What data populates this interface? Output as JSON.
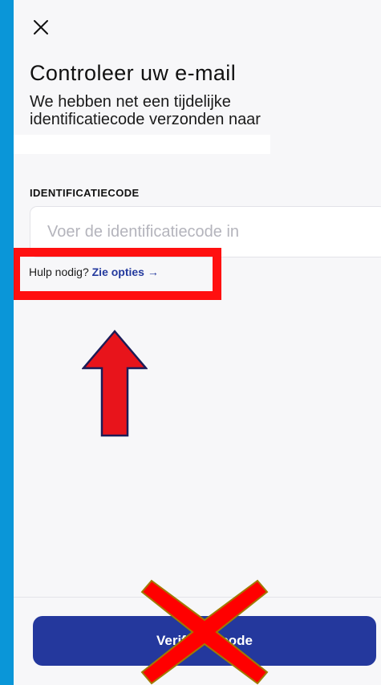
{
  "page": {
    "close_icon": "close-icon",
    "title": "Controleer uw e-mail",
    "subtitle": "We hebben net een tijdelijke identificatiecode verzonden naar",
    "email_value": ""
  },
  "form": {
    "code_label": "IDENTIFICATIECODE",
    "code_value": "",
    "code_placeholder": "Voer de identificatiecode in"
  },
  "help": {
    "prefix": "Hulp nodig?",
    "link_label": "Zie opties",
    "link_arrow": "→"
  },
  "footer": {
    "primary_button_label": "Verificatiecode"
  },
  "annotations": {
    "highlight_color": "#ff1010",
    "arrow_color": "#e8141b",
    "arrow_outline_color": "#1c1c57",
    "cross_color": "#ff0000"
  },
  "colors": {
    "backdrop": "#0a96d8",
    "sheet": "#f7f7f9",
    "accent": "#24389d"
  }
}
